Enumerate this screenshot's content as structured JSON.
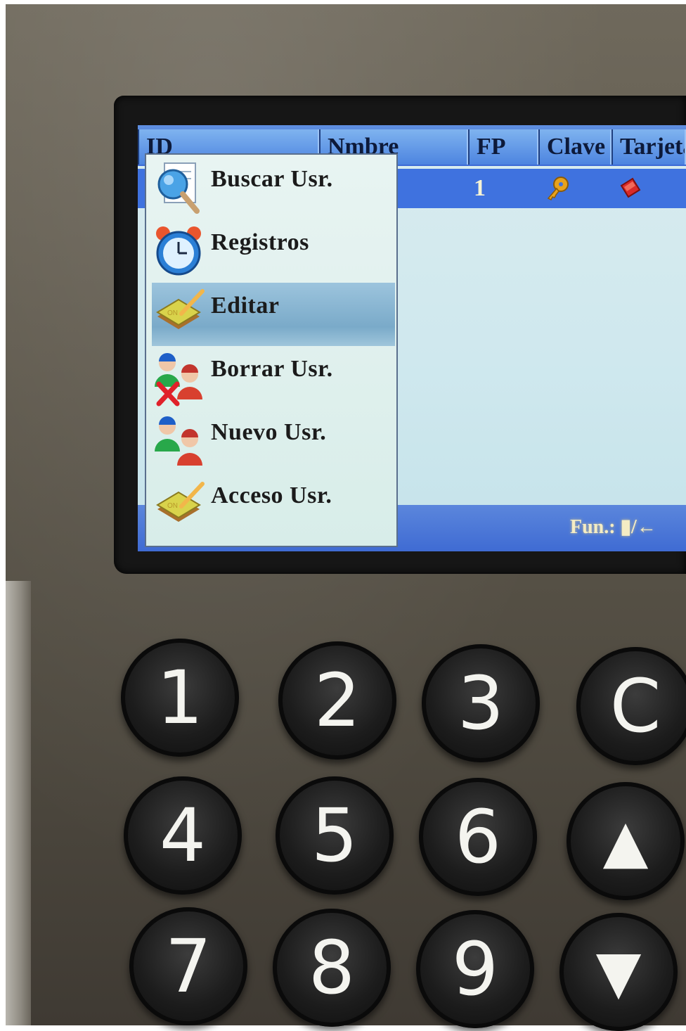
{
  "table": {
    "columns": [
      "ID",
      "Nmbre",
      "FP",
      "Clave",
      "Tarjeta"
    ],
    "selected_row": {
      "fp": "1"
    }
  },
  "menu": {
    "items": [
      {
        "label": "Buscar Usr.",
        "icon": "magnifier-document-icon"
      },
      {
        "label": "Registros",
        "icon": "alarm-clock-icon"
      },
      {
        "label": "Editar",
        "icon": "notepad-pencil-icon",
        "selected": true
      },
      {
        "label": "Borrar Usr.",
        "icon": "users-delete-icon"
      },
      {
        "label": "Nuevo Usr.",
        "icon": "users-add-icon"
      },
      {
        "label": "Acceso Usr.",
        "icon": "notepad-pencil-icon"
      }
    ]
  },
  "footer": {
    "text": "Fun.: ▮/←"
  },
  "keypad": {
    "keys": [
      "1",
      "2",
      "3",
      "C",
      "4",
      "5",
      "6",
      "▲",
      "7",
      "8",
      "9",
      "▼"
    ]
  },
  "colors": {
    "header_blue": "#4d84e0",
    "selected_row": "#3f72df",
    "menu_highlight": "#7aaac9",
    "device_body": "#5f594d"
  }
}
